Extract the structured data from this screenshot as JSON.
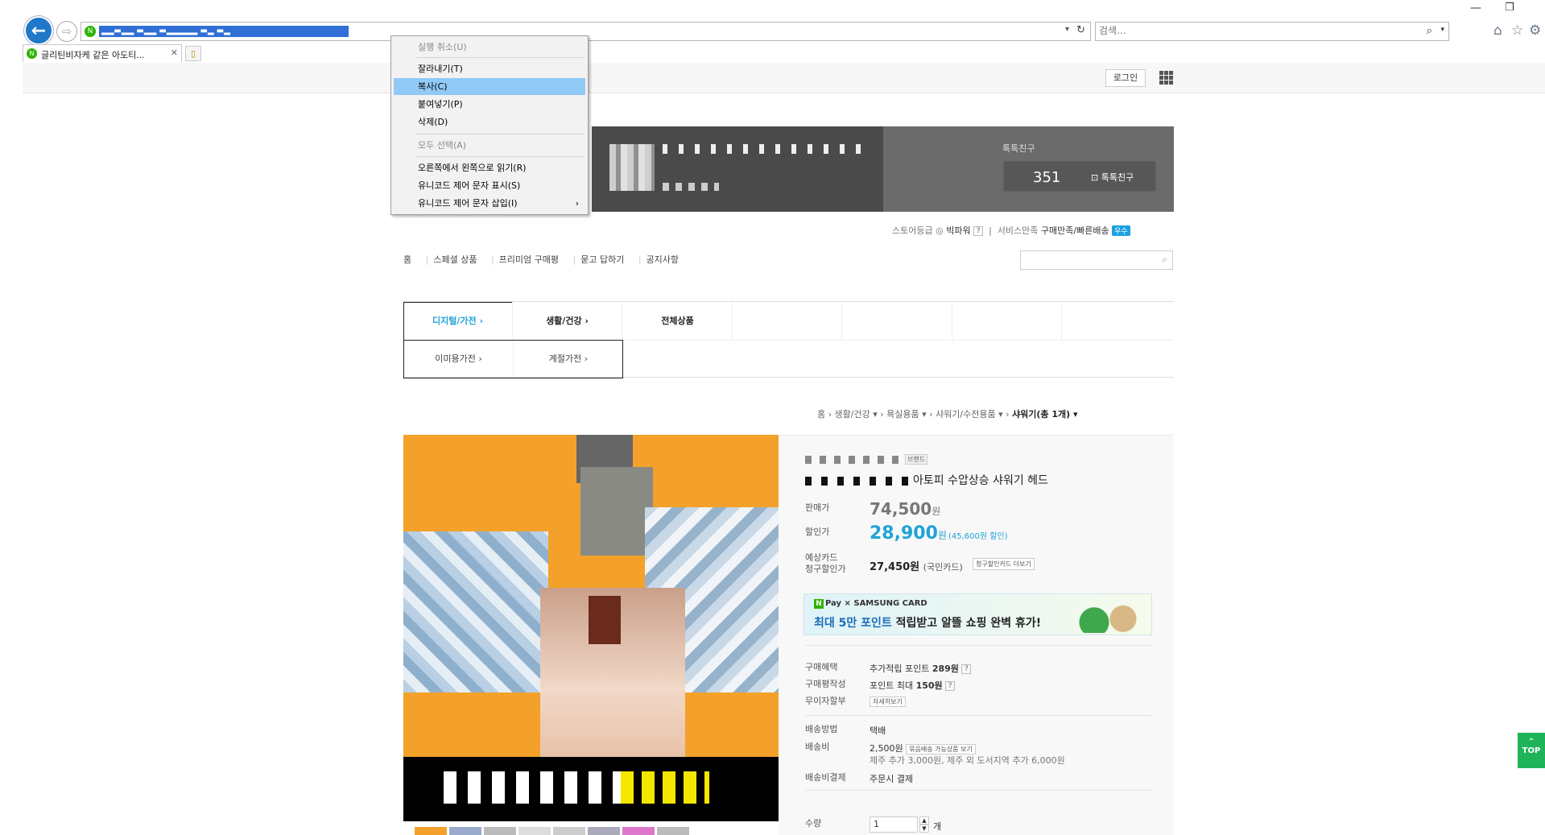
{
  "browser": {
    "address_url": "▂▂▬▂▂ ▬▂▂ ▬▂▂▂▂▂ ▬▂ ▬▂",
    "address_site_icon": "naver-store-icon",
    "search_placeholder": "검색...",
    "tab_title": "글리틴비자케 같은 아도티...",
    "icons": [
      "home-icon",
      "star-icon",
      "gear-icon"
    ]
  },
  "context_menu": {
    "items": [
      {
        "label": "실행 취소(U)",
        "disabled": true
      },
      {
        "label": "잘라내기(T)",
        "disabled": false
      },
      {
        "label": "복사(C)",
        "disabled": false,
        "highlighted": true
      },
      {
        "label": "붙여넣기(P)",
        "disabled": false
      },
      {
        "label": "삭제(D)",
        "disabled": false
      },
      {
        "label": "모두 선택(A)",
        "disabled": true
      },
      {
        "label": "오른쪽에서 왼쪽으로 읽기(R)",
        "disabled": false
      },
      {
        "label": "유니코드 제어 문자 표시(S)",
        "disabled": false
      },
      {
        "label": "유니코드 제어 문자 삽입(I)",
        "disabled": false,
        "submenu": "›"
      }
    ]
  },
  "topbar": {
    "login_label": "로그인"
  },
  "store": {
    "talk_label": "톡톡친구",
    "talk_count": "351",
    "talk_button": "톡톡친구",
    "grade_label": "스토어등급",
    "grade_value": "빅파워",
    "service_label": "서비스만족",
    "service_value": "구매만족/빠른배송",
    "service_badge": "우수"
  },
  "subnav": [
    "홈",
    "스페셜 상품",
    "프리미엄 구매평",
    "묻고 답하기",
    "공지사항"
  ],
  "categories": {
    "row1": [
      "디지털/가전 ›",
      "생활/건강 ›",
      "전체상품"
    ],
    "sub": [
      "이미용가전 ›",
      "계절가전 ›"
    ]
  },
  "breadcrumb": [
    "홈",
    "생활/건강 ▾",
    "욕실용품 ▾",
    "샤워기/수전용품 ▾",
    "샤워기(총 1개) ▾"
  ],
  "product": {
    "brand_tag": "브랜드",
    "name": "아토피 수압상승 샤워기 헤드",
    "price_label": "판매가",
    "price": "74,500",
    "won": "원",
    "sale_label": "할인가",
    "sale_price": "28,900",
    "discount_note": "(45,600원 할인)",
    "card_label_1": "예상카드",
    "card_label_2": "청구할인가",
    "card_price": "27,450원",
    "card_name": "(국민카드)",
    "card_button": "청구할인카드 더보기",
    "npay_top": "Pay × SAMSUNG CARD",
    "npay_main_blue": "최대 5만 포인트",
    "npay_main_rest": " 적립받고 알뜰 쇼핑 완벽 휴가!",
    "benefit_label": "구매혜택",
    "benefit_value_pre": "추가적립 포인트 ",
    "benefit_value_bold": "289원",
    "review_label": "구매평작성",
    "review_value_pre": "포인트 최대 ",
    "review_value_bold": "150원",
    "installment_label": "무이자할부",
    "installment_button": "자세히보기",
    "ship_method_label": "배송방법",
    "ship_method_value": "택배",
    "ship_fee_label": "배송비",
    "ship_fee_value": "2,500원",
    "ship_fee_button": "묶음배송 가능상품 보기",
    "ship_fee_note": "제주 추가 3,000원, 제주 외 도서지역 추가 6,000원",
    "ship_pay_label": "배송비결제",
    "ship_pay_value": "주문시 결제",
    "qty_label": "수량",
    "qty_value": "1",
    "qty_unit": "개"
  },
  "top_button": "TOP"
}
